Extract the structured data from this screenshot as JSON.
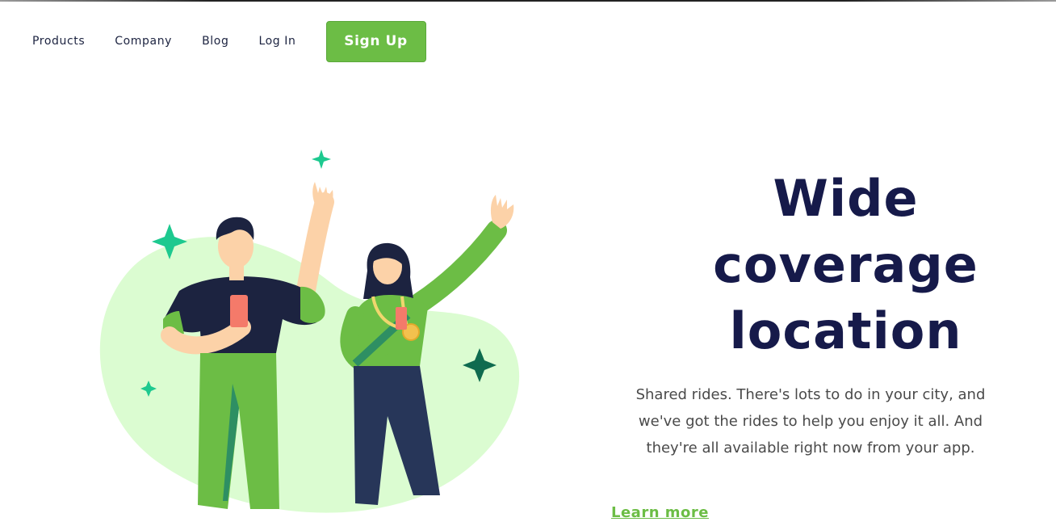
{
  "nav": {
    "items": [
      "Products",
      "Company",
      "Blog",
      "Log In"
    ],
    "signup_label": "Sign Up"
  },
  "hero": {
    "headline_line1": "Wide coverage",
    "headline_line2": "location",
    "description": "Shared rides. There's lots to do in your city, and we've got the rides to help you enjoy it all. And they're all available right now from your app.",
    "learn_more": "Learn more"
  },
  "colors": {
    "brand_green": "#6cbd45",
    "headline_navy": "#161a4a",
    "blob_green": "#dbfcd1",
    "sparkle_teal": "#1dc98f"
  },
  "icons": [
    "sparkle-icon"
  ]
}
